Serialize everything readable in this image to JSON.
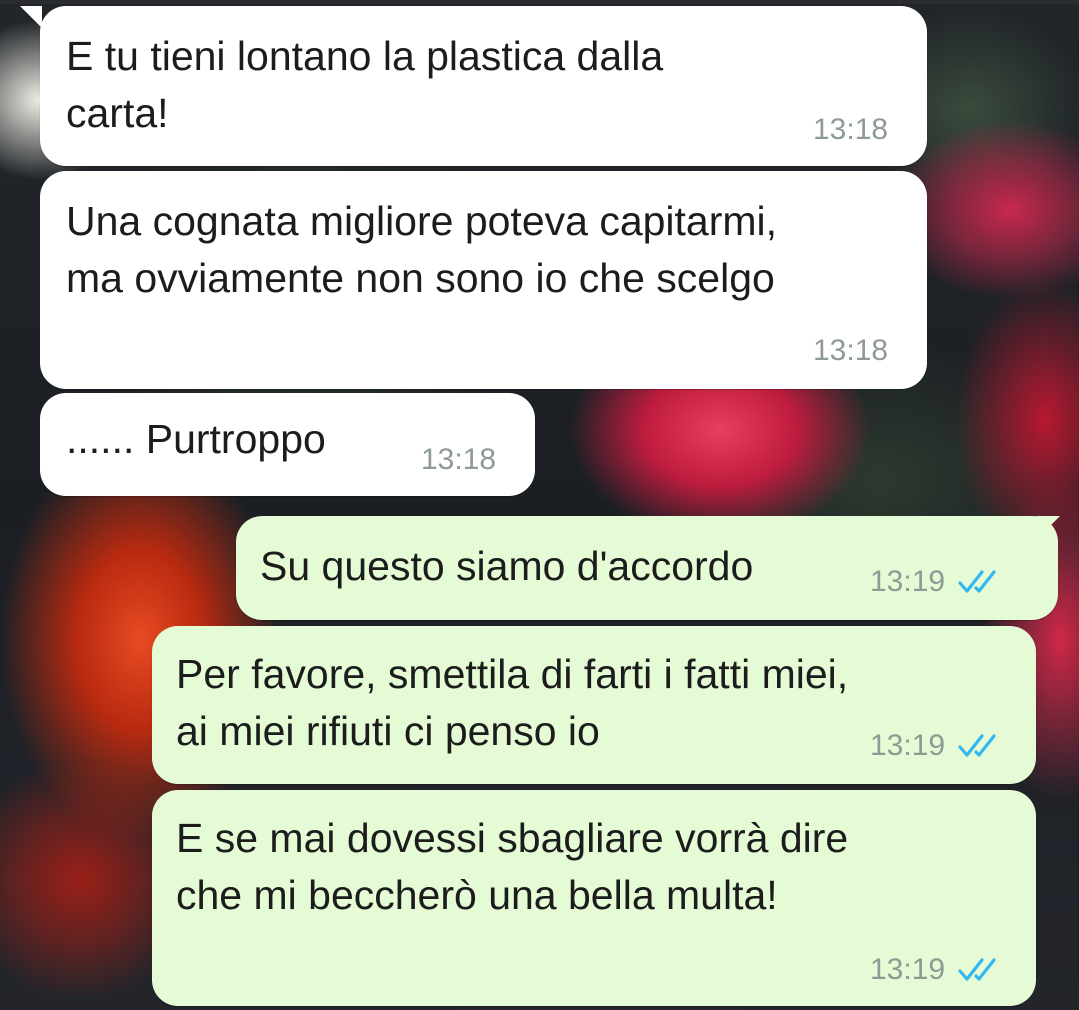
{
  "messages": [
    {
      "direction": "incoming",
      "text": "E tu tieni lontano la plastica dalla\ncarta!",
      "time": "13:18"
    },
    {
      "direction": "incoming",
      "text": "Una cognata migliore poteva capitarmi,\nma ovviamente non sono io che scelgo",
      "time": "13:18"
    },
    {
      "direction": "incoming",
      "text": "...... Purtroppo",
      "time": "13:18"
    },
    {
      "direction": "outgoing",
      "text": "Su questo siamo d'accordo",
      "time": "13:19",
      "status": "read"
    },
    {
      "direction": "outgoing",
      "text": "Per favore, smettila di farti i fatti miei,\nai miei rifiuti ci penso io",
      "time": "13:19",
      "status": "read"
    },
    {
      "direction": "outgoing",
      "text": "E se mai dovessi sbagliare vorrà dire\nche mi beccherò una bella multa!",
      "time": "13:19",
      "status": "read"
    }
  ],
  "colors": {
    "incoming_bubble": "#ffffff",
    "outgoing_bubble": "#e5fbd5",
    "timestamp": "#8e9a95",
    "read_ticks": "#34b7f1"
  },
  "icons": {
    "read_receipt": "double-check-icon",
    "wallpaper": "flower-wallpaper"
  }
}
